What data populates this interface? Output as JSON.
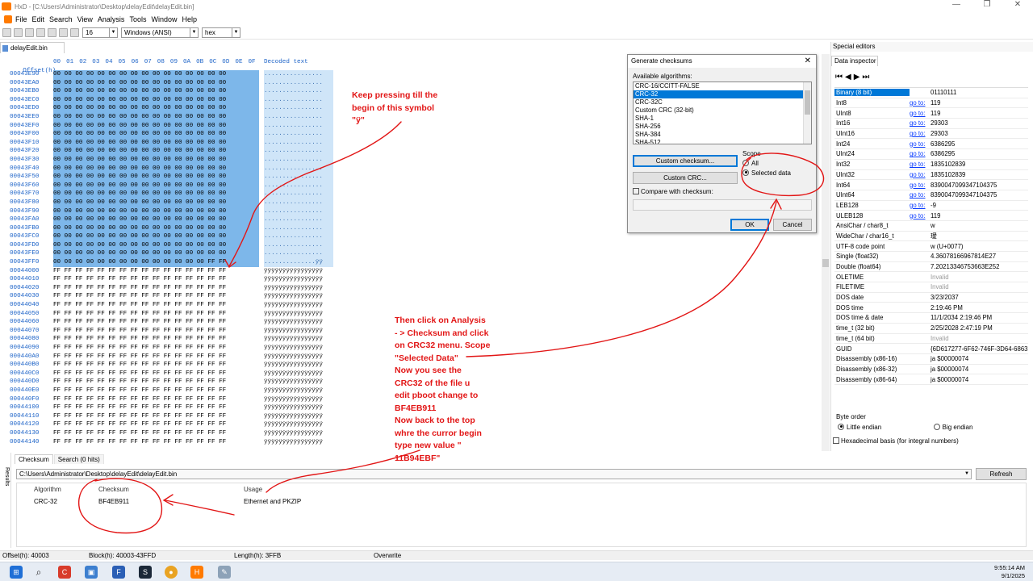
{
  "window": {
    "title": "HxD - [C:\\Users\\Administrator\\Desktop\\delayEdit\\delayEdit.bin]",
    "min": "—",
    "restore": "❐",
    "close": "✕"
  },
  "menu": [
    "File",
    "Edit",
    "Search",
    "View",
    "Analysis",
    "Tools",
    "Window",
    "Help"
  ],
  "toolbar": {
    "bytes_per_row": "16",
    "charset": "Windows (ANSI)",
    "mode": "hex"
  },
  "document_tab": "delayEdit.bin",
  "hex_header": {
    "offset_label": "Offset(h)",
    "columns": [
      "00",
      "01",
      "02",
      "03",
      "04",
      "05",
      "06",
      "07",
      "08",
      "09",
      "0A",
      "0B",
      "0C",
      "0D",
      "0E",
      "0F"
    ],
    "decoded_label": "Decoded text"
  },
  "hex_rows": [
    {
      "off": "00043E90",
      "b": "00 00 00 00 00 00 00 00 00 00 00 00 00 00 00 00",
      "d": "................",
      "sel": true
    },
    {
      "off": "00043EA0",
      "b": "00 00 00 00 00 00 00 00 00 00 00 00 00 00 00 00",
      "d": "................",
      "sel": true
    },
    {
      "off": "00043EB0",
      "b": "00 00 00 00 00 00 00 00 00 00 00 00 00 00 00 00",
      "d": "................",
      "sel": true
    },
    {
      "off": "00043EC0",
      "b": "00 00 00 00 00 00 00 00 00 00 00 00 00 00 00 00",
      "d": "................",
      "sel": true
    },
    {
      "off": "00043ED0",
      "b": "00 00 00 00 00 00 00 00 00 00 00 00 00 00 00 00",
      "d": "................",
      "sel": true
    },
    {
      "off": "00043EE0",
      "b": "00 00 00 00 00 00 00 00 00 00 00 00 00 00 00 00",
      "d": "................",
      "sel": true
    },
    {
      "off": "00043EF0",
      "b": "00 00 00 00 00 00 00 00 00 00 00 00 00 00 00 00",
      "d": "................",
      "sel": true
    },
    {
      "off": "00043F00",
      "b": "00 00 00 00 00 00 00 00 00 00 00 00 00 00 00 00",
      "d": "................",
      "sel": true
    },
    {
      "off": "00043F10",
      "b": "00 00 00 00 00 00 00 00 00 00 00 00 00 00 00 00",
      "d": "................",
      "sel": true
    },
    {
      "off": "00043F20",
      "b": "00 00 00 00 00 00 00 00 00 00 00 00 00 00 00 00",
      "d": "................",
      "sel": true
    },
    {
      "off": "00043F30",
      "b": "00 00 00 00 00 00 00 00 00 00 00 00 00 00 00 00",
      "d": "................",
      "sel": true
    },
    {
      "off": "00043F40",
      "b": "00 00 00 00 00 00 00 00 00 00 00 00 00 00 00 00",
      "d": "................",
      "sel": true
    },
    {
      "off": "00043F50",
      "b": "00 00 00 00 00 00 00 00 00 00 00 00 00 00 00 00",
      "d": "................",
      "sel": true
    },
    {
      "off": "00043F60",
      "b": "00 00 00 00 00 00 00 00 00 00 00 00 00 00 00 00",
      "d": "................",
      "sel": true
    },
    {
      "off": "00043F70",
      "b": "00 00 00 00 00 00 00 00 00 00 00 00 00 00 00 00",
      "d": "................",
      "sel": true
    },
    {
      "off": "00043F80",
      "b": "00 00 00 00 00 00 00 00 00 00 00 00 00 00 00 00",
      "d": "................",
      "sel": true
    },
    {
      "off": "00043F90",
      "b": "00 00 00 00 00 00 00 00 00 00 00 00 00 00 00 00",
      "d": "................",
      "sel": true
    },
    {
      "off": "00043FA0",
      "b": "00 00 00 00 00 00 00 00 00 00 00 00 00 00 00 00",
      "d": "................",
      "sel": true
    },
    {
      "off": "00043FB0",
      "b": "00 00 00 00 00 00 00 00 00 00 00 00 00 00 00 00",
      "d": "................",
      "sel": true
    },
    {
      "off": "00043FC0",
      "b": "00 00 00 00 00 00 00 00 00 00 00 00 00 00 00 00",
      "d": "................",
      "sel": true
    },
    {
      "off": "00043FD0",
      "b": "00 00 00 00 00 00 00 00 00 00 00 00 00 00 00 00",
      "d": "................",
      "sel": true
    },
    {
      "off": "00043FE0",
      "b": "00 00 00 00 00 00 00 00 00 00 00 00 00 00 00 00",
      "d": "................",
      "sel": true
    },
    {
      "off": "00043FF0",
      "b": "00 00 00 00 00 00 00 00 00 00 00 00 00 00 FF FF",
      "d": "..............ÿÿ",
      "sel": true
    },
    {
      "off": "00044000",
      "b": "FF FF FF FF FF FF FF FF FF FF FF FF FF FF FF FF",
      "d": "ÿÿÿÿÿÿÿÿÿÿÿÿÿÿÿÿ",
      "sel": false
    },
    {
      "off": "00044010",
      "b": "FF FF FF FF FF FF FF FF FF FF FF FF FF FF FF FF",
      "d": "ÿÿÿÿÿÿÿÿÿÿÿÿÿÿÿÿ",
      "sel": false
    },
    {
      "off": "00044020",
      "b": "FF FF FF FF FF FF FF FF FF FF FF FF FF FF FF FF",
      "d": "ÿÿÿÿÿÿÿÿÿÿÿÿÿÿÿÿ",
      "sel": false
    },
    {
      "off": "00044030",
      "b": "FF FF FF FF FF FF FF FF FF FF FF FF FF FF FF FF",
      "d": "ÿÿÿÿÿÿÿÿÿÿÿÿÿÿÿÿ",
      "sel": false
    },
    {
      "off": "00044040",
      "b": "FF FF FF FF FF FF FF FF FF FF FF FF FF FF FF FF",
      "d": "ÿÿÿÿÿÿÿÿÿÿÿÿÿÿÿÿ",
      "sel": false
    },
    {
      "off": "00044050",
      "b": "FF FF FF FF FF FF FF FF FF FF FF FF FF FF FF FF",
      "d": "ÿÿÿÿÿÿÿÿÿÿÿÿÿÿÿÿ",
      "sel": false
    },
    {
      "off": "00044060",
      "b": "FF FF FF FF FF FF FF FF FF FF FF FF FF FF FF FF",
      "d": "ÿÿÿÿÿÿÿÿÿÿÿÿÿÿÿÿ",
      "sel": false
    },
    {
      "off": "00044070",
      "b": "FF FF FF FF FF FF FF FF FF FF FF FF FF FF FF FF",
      "d": "ÿÿÿÿÿÿÿÿÿÿÿÿÿÿÿÿ",
      "sel": false
    },
    {
      "off": "00044080",
      "b": "FF FF FF FF FF FF FF FF FF FF FF FF FF FF FF FF",
      "d": "ÿÿÿÿÿÿÿÿÿÿÿÿÿÿÿÿ",
      "sel": false
    },
    {
      "off": "00044090",
      "b": "FF FF FF FF FF FF FF FF FF FF FF FF FF FF FF FF",
      "d": "ÿÿÿÿÿÿÿÿÿÿÿÿÿÿÿÿ",
      "sel": false
    },
    {
      "off": "000440A0",
      "b": "FF FF FF FF FF FF FF FF FF FF FF FF FF FF FF FF",
      "d": "ÿÿÿÿÿÿÿÿÿÿÿÿÿÿÿÿ",
      "sel": false
    },
    {
      "off": "000440B0",
      "b": "FF FF FF FF FF FF FF FF FF FF FF FF FF FF FF FF",
      "d": "ÿÿÿÿÿÿÿÿÿÿÿÿÿÿÿÿ",
      "sel": false
    },
    {
      "off": "000440C0",
      "b": "FF FF FF FF FF FF FF FF FF FF FF FF FF FF FF FF",
      "d": "ÿÿÿÿÿÿÿÿÿÿÿÿÿÿÿÿ",
      "sel": false
    },
    {
      "off": "000440D0",
      "b": "FF FF FF FF FF FF FF FF FF FF FF FF FF FF FF FF",
      "d": "ÿÿÿÿÿÿÿÿÿÿÿÿÿÿÿÿ",
      "sel": false
    },
    {
      "off": "000440E0",
      "b": "FF FF FF FF FF FF FF FF FF FF FF FF FF FF FF FF",
      "d": "ÿÿÿÿÿÿÿÿÿÿÿÿÿÿÿÿ",
      "sel": false
    },
    {
      "off": "000440F0",
      "b": "FF FF FF FF FF FF FF FF FF FF FF FF FF FF FF FF",
      "d": "ÿÿÿÿÿÿÿÿÿÿÿÿÿÿÿÿ",
      "sel": false
    },
    {
      "off": "00044100",
      "b": "FF FF FF FF FF FF FF FF FF FF FF FF FF FF FF FF",
      "d": "ÿÿÿÿÿÿÿÿÿÿÿÿÿÿÿÿ",
      "sel": false
    },
    {
      "off": "00044110",
      "b": "FF FF FF FF FF FF FF FF FF FF FF FF FF FF FF FF",
      "d": "ÿÿÿÿÿÿÿÿÿÿÿÿÿÿÿÿ",
      "sel": false
    },
    {
      "off": "00044120",
      "b": "FF FF FF FF FF FF FF FF FF FF FF FF FF FF FF FF",
      "d": "ÿÿÿÿÿÿÿÿÿÿÿÿÿÿÿÿ",
      "sel": false
    },
    {
      "off": "00044130",
      "b": "FF FF FF FF FF FF FF FF FF FF FF FF FF FF FF FF",
      "d": "ÿÿÿÿÿÿÿÿÿÿÿÿÿÿÿÿ",
      "sel": false
    },
    {
      "off": "00044140",
      "b": "FF FF FF FF FF FF FF FF FF FF FF FF FF FF FF FF",
      "d": "ÿÿÿÿÿÿÿÿÿÿÿÿÿÿÿÿ",
      "sel": false
    }
  ],
  "panel": {
    "title": "Special editors",
    "tab": "Data inspector",
    "nav": "⏮◀▶⏭",
    "goto": "go to:",
    "rows": [
      {
        "n": "Binary (8 bit)",
        "g": false,
        "v": "01110111",
        "sel": true,
        "inv": false
      },
      {
        "n": "Int8",
        "g": true,
        "v": "119",
        "sel": false,
        "inv": false
      },
      {
        "n": "UInt8",
        "g": true,
        "v": "119",
        "sel": false,
        "inv": false
      },
      {
        "n": "Int16",
        "g": true,
        "v": "29303",
        "sel": false,
        "inv": false
      },
      {
        "n": "UInt16",
        "g": true,
        "v": "29303",
        "sel": false,
        "inv": false
      },
      {
        "n": "Int24",
        "g": true,
        "v": "6386295",
        "sel": false,
        "inv": false
      },
      {
        "n": "UInt24",
        "g": true,
        "v": "6386295",
        "sel": false,
        "inv": false
      },
      {
        "n": "Int32",
        "g": true,
        "v": "1835102839",
        "sel": false,
        "inv": false
      },
      {
        "n": "UInt32",
        "g": true,
        "v": "1835102839",
        "sel": false,
        "inv": false
      },
      {
        "n": "Int64",
        "g": true,
        "v": "8390047099347104375",
        "sel": false,
        "inv": false
      },
      {
        "n": "UInt64",
        "g": true,
        "v": "8390047099347104375",
        "sel": false,
        "inv": false
      },
      {
        "n": "LEB128",
        "g": true,
        "v": "-9",
        "sel": false,
        "inv": false
      },
      {
        "n": "ULEB128",
        "g": true,
        "v": "119",
        "sel": false,
        "inv": false
      },
      {
        "n": "AnsiChar / char8_t",
        "g": false,
        "v": "w",
        "sel": false,
        "inv": false
      },
      {
        "n": "WideChar / char16_t",
        "g": false,
        "v": "瑷",
        "sel": false,
        "inv": false
      },
      {
        "n": "UTF-8 code point",
        "g": false,
        "v": "w (U+0077)",
        "sel": false,
        "inv": false
      },
      {
        "n": "Single (float32)",
        "g": false,
        "v": "4.36078166967814E27",
        "sel": false,
        "inv": false
      },
      {
        "n": "Double (float64)",
        "g": false,
        "v": "7.20213346753663E252",
        "sel": false,
        "inv": false
      },
      {
        "n": "OLETIME",
        "g": false,
        "v": "Invalid",
        "sel": false,
        "inv": true
      },
      {
        "n": "FILETIME",
        "g": false,
        "v": "Invalid",
        "sel": false,
        "inv": true
      },
      {
        "n": "DOS date",
        "g": false,
        "v": "3/23/2037",
        "sel": false,
        "inv": false
      },
      {
        "n": "DOS time",
        "g": false,
        "v": "2:19:46 PM",
        "sel": false,
        "inv": false
      },
      {
        "n": "DOS time & date",
        "g": false,
        "v": "11/1/2034 2:19:46 PM",
        "sel": false,
        "inv": false
      },
      {
        "n": "time_t (32 bit)",
        "g": false,
        "v": "2/25/2028 2:47:19 PM",
        "sel": false,
        "inv": false
      },
      {
        "n": "time_t (64 bit)",
        "g": false,
        "v": "Invalid",
        "sel": false,
        "inv": true
      },
      {
        "n": "GUID",
        "g": false,
        "v": "{6D617277-6F62-746F-3D64-6863",
        "sel": false,
        "inv": false
      },
      {
        "n": "Disassembly (x86-16)",
        "g": false,
        "v": "ja $00000074",
        "sel": false,
        "inv": false
      },
      {
        "n": "Disassembly (x86-32)",
        "g": false,
        "v": "ja $00000074",
        "sel": false,
        "inv": false
      },
      {
        "n": "Disassembly (x86-64)",
        "g": false,
        "v": "ja $00000074",
        "sel": false,
        "inv": false
      }
    ],
    "byte_order": "Byte order",
    "little": "Little endian",
    "big": "Big endian",
    "hexbasis": "Hexadecimal basis (for integral numbers)"
  },
  "dialog": {
    "title": "Generate checksums",
    "close": "✕",
    "algos_label": "Available algorithms:",
    "algos": [
      "CRC-16/CCITT-FALSE",
      "CRC-32",
      "CRC-32C",
      "Custom CRC (32-bit)",
      "SHA-1",
      "SHA-256",
      "SHA-384",
      "SHA-512"
    ],
    "selected_index": 1,
    "custom_checksum": "Custom checksum...",
    "custom_crc": "Custom CRC...",
    "scope": "Scope",
    "all": "All",
    "selected": "Selected data",
    "compare": "Compare with checksum:",
    "ok": "OK",
    "cancel": "Cancel"
  },
  "results": {
    "side_label": "Results",
    "tabs": [
      "Checksum",
      "Search (0 hits)"
    ],
    "path": "C:\\Users\\Administrator\\Desktop\\delayEdit\\delayEdit.bin",
    "refresh": "Refresh",
    "headers": [
      "Algorithm",
      "Checksum",
      "Usage"
    ],
    "row": {
      "algo": "CRC-32",
      "checksum": "BF4EB911",
      "usage": "Ethernet and PKZIP"
    }
  },
  "status": {
    "offset": "Offset(h): 40003",
    "block": "Block(h): 40003-43FFD",
    "length": "Length(h): 3FFB",
    "mode": "Overwrite"
  },
  "clock": {
    "time": "9:55:14 AM",
    "date": "9/1/2025"
  },
  "taskbar_icons": [
    "windows-icon",
    "search-icon",
    "cc-icon",
    "pc-icon",
    "file-icon",
    "steam-icon",
    "chrome-icon",
    "hxd-icon",
    "app-icon"
  ],
  "annotations": {
    "top": [
      "Keep pressing till the",
      "begin of this symbol",
      "\"ÿ\""
    ],
    "main": [
      "Then click on Analysis",
      "- > Checksum and click",
      "on CRC32 menu. Scope",
      "\"Selected Data\"",
      "Now you see the",
      "CRC32 of the file u",
      "edit pboot change to",
      "BF4EB911",
      "Now back to the top",
      "whre the curror begin",
      "type new value \"",
      "11B94EBF\""
    ]
  },
  "colors": {
    "selection": "#7db7ea",
    "accent": "#0078d7",
    "annotation": "#e21616",
    "offset": "#1e64c8"
  }
}
